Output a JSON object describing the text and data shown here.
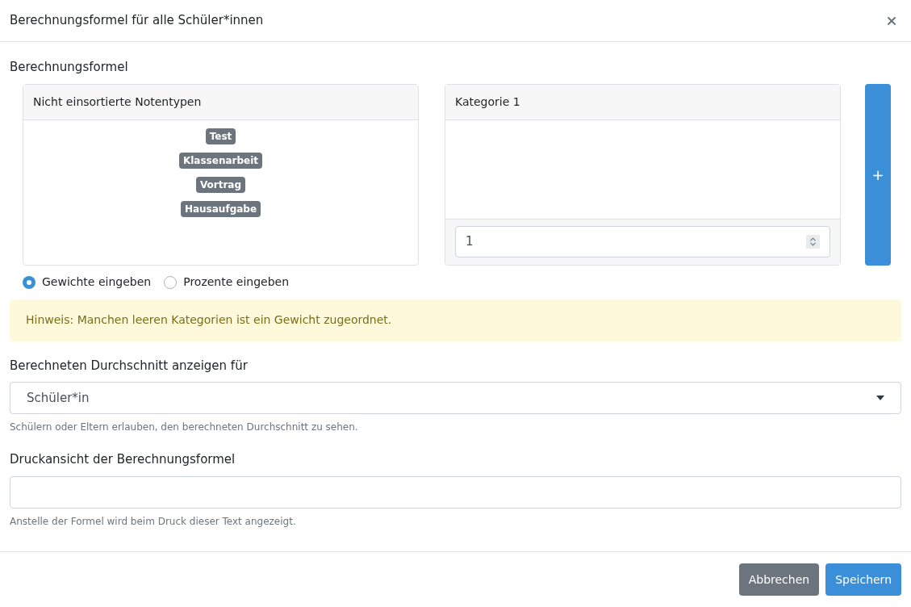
{
  "dialog": {
    "title": "Berechnungsformel für alle Schüler*innen"
  },
  "formula": {
    "label": "Berechnungsformel",
    "unsorted": {
      "title": "Nicht einsortierte Notentypen",
      "tags": [
        "Test",
        "Klassenarbeit",
        "Vortrag",
        "Hausaufgabe"
      ]
    },
    "categories": [
      {
        "title": "Kategorie 1",
        "weight": "1"
      }
    ],
    "add_button": "+"
  },
  "mode_options": [
    {
      "label": "Gewichte eingeben",
      "selected": true
    },
    {
      "label": "Prozente eingeben",
      "selected": false
    }
  ],
  "alert": "Hinweis: Manchen leeren Kategorien ist ein Gewicht zugeordnet.",
  "average": {
    "label": "Berechneten Durchschnitt anzeigen für",
    "value": "Schüler*in",
    "help": "Schülern oder Eltern erlauben, den berechneten Durchschnitt zu sehen."
  },
  "print_view": {
    "label": "Druckansicht der Berechnungsformel",
    "help": "Anstelle der Formel wird beim Druck dieser Text angezeigt."
  },
  "buttons": [
    {
      "label": "Abbrechen",
      "kind": "secondary"
    },
    {
      "label": "Speichern",
      "kind": "primary"
    }
  ]
}
